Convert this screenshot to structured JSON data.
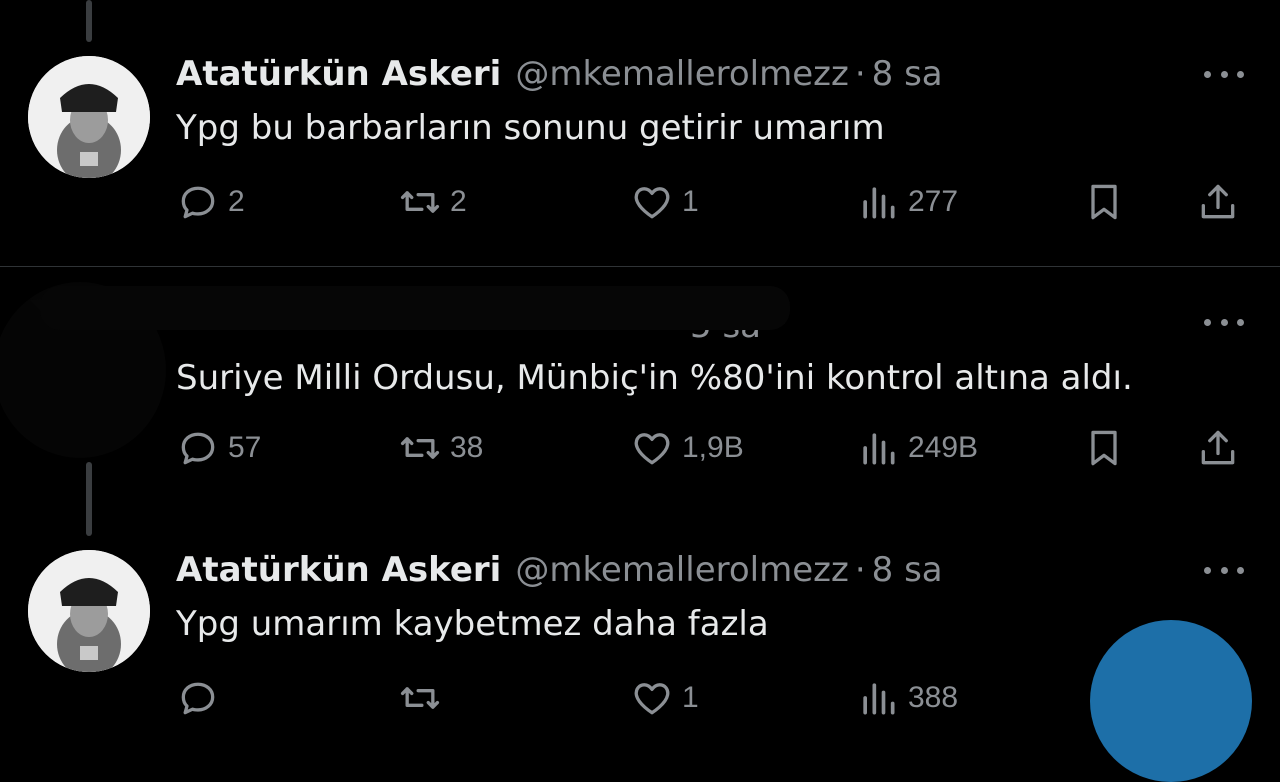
{
  "tweets": [
    {
      "name": "Atatürkün Askeri",
      "handle": "@mkemallerolmezz",
      "sep": "·",
      "time": "8 sa",
      "text": "Ypg bu barbarların sonunu getirir umarım",
      "replies": "2",
      "retweets": "2",
      "likes": "1",
      "views": "277"
    },
    {
      "time_fragment": "5 sa",
      "text": "Suriye Milli Ordusu, Münbiç'in %80'ini kontrol altına aldı.",
      "replies": "57",
      "retweets": "38",
      "likes": "1,9B",
      "views": "249B"
    },
    {
      "name": "Atatürkün Askeri",
      "handle": "@mkemallerolmezz",
      "sep": "·",
      "time": "8 sa",
      "text": "Ypg umarım kaybetmez daha fazla",
      "replies": "",
      "retweets": "",
      "likes": "1",
      "views": "388"
    }
  ],
  "icons": {
    "reply": "reply-icon",
    "retweet": "retweet-icon",
    "like": "heart-icon",
    "views": "views-icon",
    "bookmark": "bookmark-icon",
    "share": "share-icon",
    "more": "more-icon"
  },
  "colors": {
    "background": "#000000",
    "text": "#e7e9ea",
    "muted": "#8b8f94",
    "fab": "#1d6fa8"
  }
}
